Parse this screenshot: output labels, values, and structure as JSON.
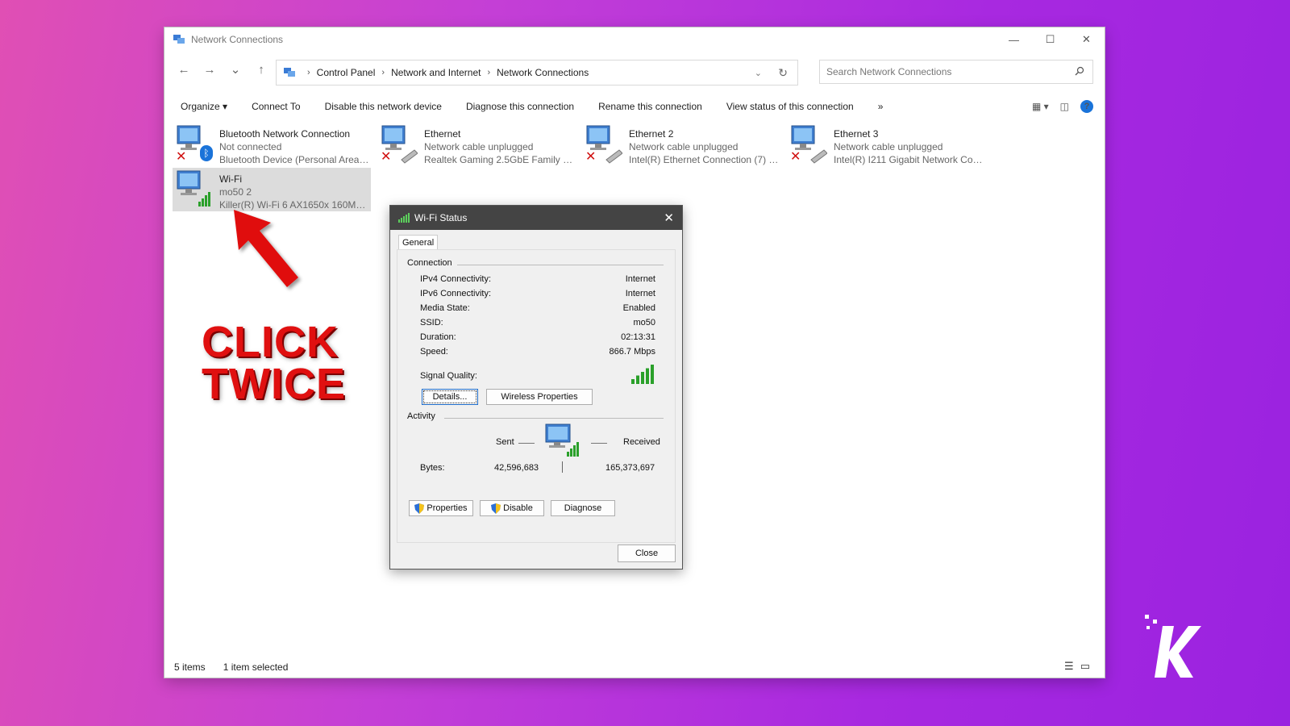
{
  "window": {
    "title": "Network Connections",
    "controls": {
      "minimize": "—",
      "maximize": "☐",
      "close": "✕"
    }
  },
  "nav": {
    "back": "←",
    "forward": "→",
    "recent": "⌄",
    "up": "↑",
    "breadcrumb": [
      "Control Panel",
      "Network and Internet",
      "Network Connections"
    ],
    "search_placeholder": "Search Network Connections"
  },
  "toolbar": {
    "organize": "Organize ▾",
    "connect_to": "Connect To",
    "disable_device": "Disable this network device",
    "diagnose": "Diagnose this connection",
    "rename": "Rename this connection",
    "view_status": "View status of this connection",
    "more": "»",
    "help": "?"
  },
  "connections": [
    {
      "name": "Bluetooth Network Connection",
      "status": "Not connected",
      "device": "Bluetooth Device (Personal Area ..."
    },
    {
      "name": "Ethernet",
      "status": "Network cable unplugged",
      "device": "Realtek Gaming 2.5GbE Family Co..."
    },
    {
      "name": "Ethernet 2",
      "status": "Network cable unplugged",
      "device": "Intel(R) Ethernet Connection (7) I..."
    },
    {
      "name": "Ethernet 3",
      "status": "Network cable unplugged",
      "device": "Intel(R) I211 Gigabit Network Con..."
    },
    {
      "name": "Wi-Fi",
      "status": "mo50 2",
      "device": "Killer(R) Wi-Fi 6 AX1650x 160MHz ..."
    }
  ],
  "statusbar": {
    "items": "5 items",
    "selected": "1 item selected"
  },
  "dialog": {
    "title": "Wi-Fi Status",
    "tab": "General",
    "connection_group": "Connection",
    "rows": [
      {
        "label": "IPv4 Connectivity:",
        "value": "Internet"
      },
      {
        "label": "IPv6 Connectivity:",
        "value": "Internet"
      },
      {
        "label": "Media State:",
        "value": "Enabled"
      },
      {
        "label": "SSID:",
        "value": "mo50"
      },
      {
        "label": "Duration:",
        "value": "02:13:31"
      },
      {
        "label": "Speed:",
        "value": "866.7 Mbps"
      }
    ],
    "signal_label": "Signal Quality:",
    "signal_bars": 5,
    "details_btn": "Details...",
    "wireless_btn": "Wireless Properties",
    "activity_group": "Activity",
    "sent": "Sent",
    "received": "Received",
    "bytes_label": "Bytes:",
    "bytes_sent": "42,596,683",
    "bytes_received": "165,373,697",
    "properties_btn": "Properties",
    "disable_btn": "Disable",
    "diagnose_btn": "Diagnose",
    "close_btn": "Close"
  },
  "annotation": {
    "line1": "CLICK",
    "line2": "TWICE"
  },
  "colors": {
    "accent": "#1a73d9",
    "annotation": "#e01010",
    "signal": "#2aa02a"
  }
}
